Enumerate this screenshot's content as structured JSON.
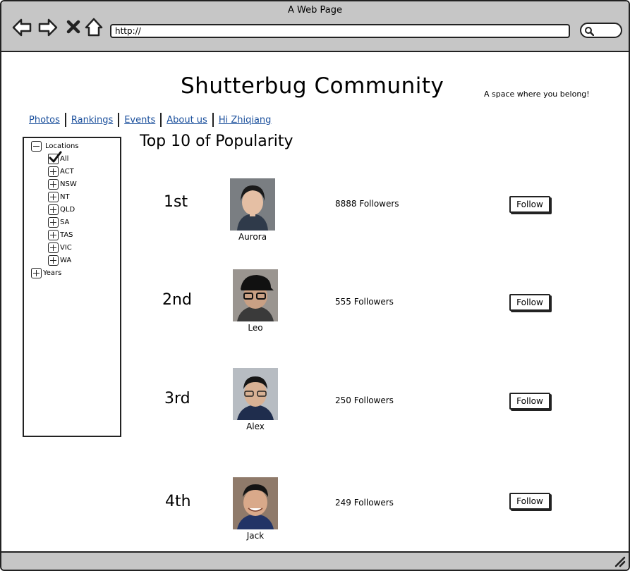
{
  "window": {
    "title": "A Web Page",
    "url": "http://"
  },
  "site": {
    "title": "Shutterbug Community",
    "tagline": "A space where you belong!"
  },
  "nav": [
    "Photos",
    "Rankings",
    "Events",
    "About us",
    "Hi Zhiqiang"
  ],
  "filter_tree": {
    "locations_label": "Locations",
    "locations_expanded": true,
    "items": [
      {
        "label": "All",
        "checked": true
      },
      {
        "label": "ACT"
      },
      {
        "label": "NSW"
      },
      {
        "label": "NT"
      },
      {
        "label": "QLD"
      },
      {
        "label": "SA"
      },
      {
        "label": "TAS"
      },
      {
        "label": "VIC"
      },
      {
        "label": "WA"
      }
    ],
    "years_label": "Years"
  },
  "section_title": "Top 10 of Popularity",
  "rankings": [
    {
      "rank": "1st",
      "name": "Aurora",
      "followers": "8888 Followers",
      "button": "Follow"
    },
    {
      "rank": "2nd",
      "name": "Leo",
      "followers": "555 Followers",
      "button": "Follow"
    },
    {
      "rank": "3rd",
      "name": "Alex",
      "followers": "250 Followers",
      "button": "Follow"
    },
    {
      "rank": "4th",
      "name": "Jack",
      "followers": "249 Followers",
      "button": "Follow"
    }
  ],
  "icons": {
    "back": "back-arrow-icon",
    "forward": "forward-arrow-icon",
    "close": "close-icon",
    "home": "home-icon",
    "search": "search-icon",
    "resize": "resize-grip-icon"
  },
  "colors": {
    "chrome": "#c6c6c6",
    "link": "#1a4f9c"
  }
}
